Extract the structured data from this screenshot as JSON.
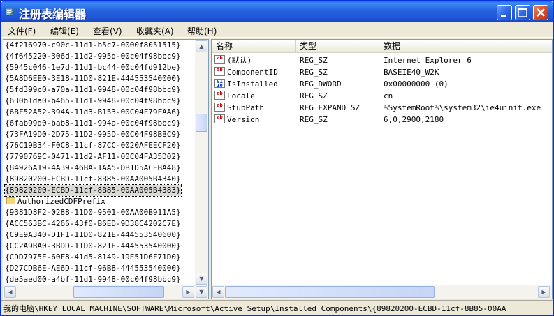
{
  "window": {
    "title": "注册表编辑器"
  },
  "menu": [
    {
      "label": "文件(F)"
    },
    {
      "label": "编辑(E)"
    },
    {
      "label": "查看(V)"
    },
    {
      "label": "收藏夹(A)"
    },
    {
      "label": "帮助(H)"
    }
  ],
  "tree": {
    "items": [
      "{4f216970-c90c-11d1-b5c7-0000f8051515}",
      "{4f645220-306d-11d2-995d-00c04f98bbc9}",
      "{5945c046-1e7d-11d1-bc44-00c04fd912be}",
      "{5A8D6EE0-3E18-11D0-821E-444553540000}",
      "{5fd399c0-a70a-11d1-9948-00c04f98bbc9}",
      "{630b1da0-b465-11d1-9948-00c04f98bbc9}",
      "{6BF52A52-394A-11d3-B153-00C04F79FAA6}",
      "{6fab99d0-bab8-11d1-994a-00c04f98bbc9}",
      "{73FA19D0-2D75-11D2-995D-00C04F98BBC9}",
      "{76C19B34-F0C8-11cf-87CC-0020AFEECF20}",
      "{7790769C-0471-11d2-AF11-00C04FA35D02}",
      "{84926A19-4A39-46BA-1AA5-DB1D5ACEBA48}",
      "{89820200-ECBD-11cf-8B85-00AA005B4340}",
      "{89820200-ECBD-11cf-8B85-00AA005B4383}",
      "AuthorizedCDFPrefix",
      "{9381D8F2-0288-11D0-9501-00AA00B911A5}",
      "{ACC563BC-4266-43f0-B6ED-9D38C4202C7E}",
      "{C9E9A340-D1F1-11D0-821E-444553540600}",
      "{CC2A9BA0-3BDD-11D0-821E-444553540000}",
      "{CDD7975E-60F8-41d5-8149-19E51D6F71D0}",
      "{D27CDB6E-AE6D-11cf-96B8-444553540000}",
      "{de5aed00-a4bf-11d1-9948-00c04f98bbc9}"
    ]
  },
  "columns": {
    "name": "名称",
    "type": "类型",
    "data": "数据"
  },
  "values": [
    {
      "icon": "ab",
      "name": "(默认)",
      "type": "REG_SZ",
      "data": "Internet Explorer 6"
    },
    {
      "icon": "ab",
      "name": "ComponentID",
      "type": "REG_SZ",
      "data": "BASEIE40_W2K"
    },
    {
      "icon": "bin",
      "name": "IsInstalled",
      "type": "REG_DWORD",
      "data": "0x00000000 (0)"
    },
    {
      "icon": "ab",
      "name": "Locale",
      "type": "REG_SZ",
      "data": "cn"
    },
    {
      "icon": "ab",
      "name": "StubPath",
      "type": "REG_EXPAND_SZ",
      "data": "%SystemRoot%\\system32\\ie4uinit.exe"
    },
    {
      "icon": "ab",
      "name": "Version",
      "type": "REG_SZ",
      "data": "6,0,2900,2180"
    }
  ],
  "status": {
    "path": "我的电脑\\HKEY_LOCAL_MACHINE\\SOFTWARE\\Microsoft\\Active Setup\\Installed Components\\{89820200-ECBD-11cf-8B85-00AA"
  }
}
